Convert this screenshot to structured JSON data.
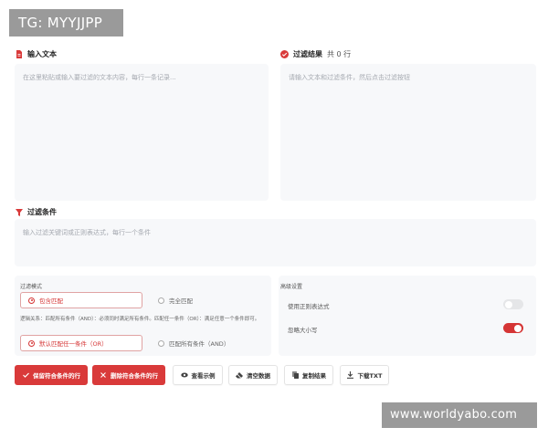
{
  "watermarks": {
    "top": "TG: MYYJJPP",
    "bottom": "www.worldyabo.com"
  },
  "input": {
    "title": "输入文本",
    "placeholder": "在这里粘贴或输入要过滤的文本内容，每行一条记录..."
  },
  "result": {
    "title": "过滤结果",
    "count_label": "共 0 行",
    "placeholder": "请输入文本和过滤条件，然后点击过滤按钮"
  },
  "conditions": {
    "title": "过滤条件",
    "placeholder": "输入过滤关键词或正则表达式，每行一个条件"
  },
  "filter_mode": {
    "label": "过滤模式",
    "options": [
      {
        "label": "包含匹配",
        "selected": true
      },
      {
        "label": "完全匹配",
        "selected": false
      }
    ]
  },
  "logic": {
    "description": "逻辑关系：匹配所有条件（AND）：必须同时满足所有条件。匹配任一条件（OR）：满足任意一个条件即可。",
    "options": [
      {
        "label": "默认匹配任一条件（OR）",
        "selected": true
      },
      {
        "label": "匹配所有条件（AND）",
        "selected": false
      }
    ]
  },
  "advanced": {
    "label": "高级设置",
    "toggles": [
      {
        "label": "使用正则表达式",
        "on": false
      },
      {
        "label": "忽略大小写",
        "on": true
      }
    ]
  },
  "buttons": {
    "keep": "保留符合条件的行",
    "delete": "删除符合条件的行",
    "example": "查看示例",
    "clear": "清空数据",
    "copy": "复制结果",
    "download": "下载TXT"
  },
  "colors": {
    "accent": "#d93a3a",
    "panel_bg": "#f7f8fa"
  }
}
